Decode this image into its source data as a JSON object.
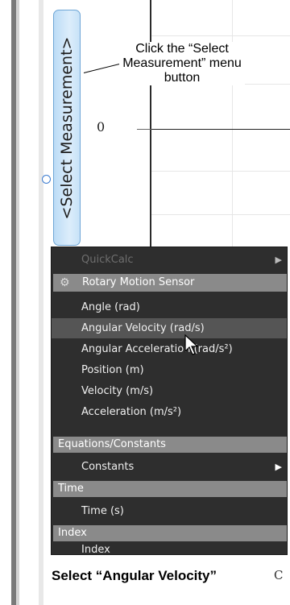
{
  "select_button": {
    "label": "<Select Measurement>"
  },
  "callout": {
    "text": "Click the “Select Measurement” menu button"
  },
  "graph": {
    "zero_label": "0"
  },
  "menu": {
    "items": [
      {
        "label": "QuickCalc",
        "kind": "disabled",
        "submenu": true
      },
      {
        "label": "Rotary Motion Sensor",
        "kind": "sensor-header",
        "icon": "sensor-icon"
      },
      {
        "label": "Angle (rad)",
        "kind": "item"
      },
      {
        "label": "Angular Velocity (rad/s)",
        "kind": "highlight"
      },
      {
        "label": "Angular Acceleration (rad/s²)",
        "kind": "item"
      },
      {
        "label": "Position (m)",
        "kind": "item"
      },
      {
        "label": "Velocity (m/s)",
        "kind": "item"
      },
      {
        "label": "Acceleration (m/s²)",
        "kind": "item"
      },
      {
        "label": "Equations/Constants",
        "kind": "header"
      },
      {
        "label": "Constants",
        "kind": "item",
        "submenu": true
      },
      {
        "label": "Time",
        "kind": "header"
      },
      {
        "label": "Time (s)",
        "kind": "item"
      },
      {
        "label": "Index",
        "kind": "header"
      },
      {
        "label": "Index",
        "kind": "item"
      }
    ]
  },
  "caption": {
    "text": "Select “Angular Velocity”",
    "side_letter": "C"
  },
  "colors": {
    "menu_bg": "#2e2e2e",
    "header_bg": "#8a8a8a",
    "highlight_bg": "#555555",
    "button_blue": "#c7e2f7"
  }
}
